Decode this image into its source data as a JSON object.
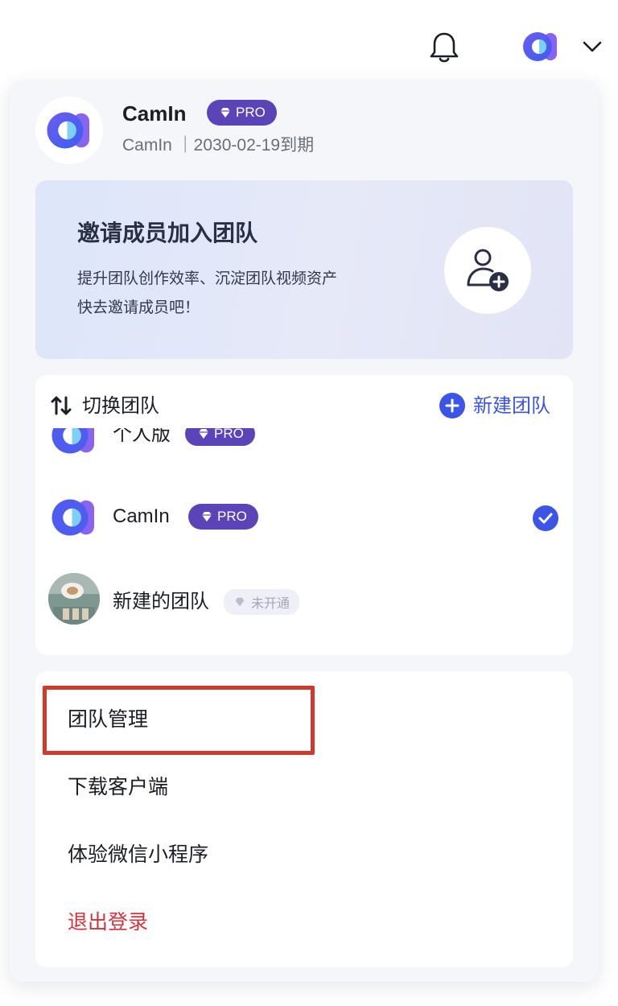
{
  "topbar": {
    "bell_icon": "bell-icon",
    "avatar_icon": "camin-logo-icon",
    "dropdown_icon": "chevron-down-icon"
  },
  "account": {
    "name": "CamIn",
    "plan_badge": "PRO",
    "subtitle": "CamIn ｜2030-02-19到期"
  },
  "invite": {
    "title": "邀请成员加入团队",
    "desc_line1": "提升团队创作效率、沉淀团队视频资产",
    "desc_line2": "快去邀请成员吧！",
    "icon": "add-user-icon"
  },
  "teams": {
    "switch_label": "切换团队",
    "new_team_label": "新建团队",
    "items": [
      {
        "name": "个人版",
        "badge": "PRO",
        "selected": false
      },
      {
        "name": "CamIn",
        "badge": "PRO",
        "selected": true
      },
      {
        "name": "新建的团队",
        "badge": "未开通",
        "selected": false
      }
    ]
  },
  "menu": {
    "items": [
      {
        "label": "团队管理",
        "highlighted": true
      },
      {
        "label": "下载客户端"
      },
      {
        "label": "体验微信小程序"
      },
      {
        "label": "退出登录",
        "danger": true
      }
    ]
  },
  "colors": {
    "accent": "#3c55e6",
    "pro_badge": "#5b43b8",
    "danger": "#d0343d",
    "highlight_border": "#d03a2d"
  }
}
